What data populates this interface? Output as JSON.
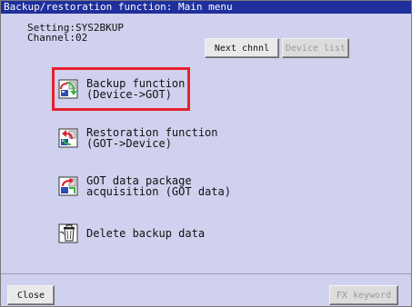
{
  "window": {
    "title": "Backup/restoration function: Main menu"
  },
  "info": {
    "setting": "Setting:SYS2BKUP",
    "channel": "Channel:02"
  },
  "buttons": {
    "next_chnl": "Next chnnl",
    "device_list": "Device list",
    "close": "Close",
    "fx_keyword": "FX keyword"
  },
  "menu": [
    {
      "label": "Backup function\n(Device->GOT)",
      "icon": "backup-icon",
      "selected": true
    },
    {
      "label": "Restoration function\n(GOT->Device)",
      "icon": "restore-icon"
    },
    {
      "label": "GOT data package\nacquisition (GOT data)",
      "icon": "package-acquisition-icon"
    },
    {
      "label": "Delete backup data",
      "icon": "delete-icon"
    }
  ],
  "colors": {
    "title_bg": "#1f2f9c",
    "panel_bg": "#cfd1ee",
    "highlight": "#e8202a"
  }
}
